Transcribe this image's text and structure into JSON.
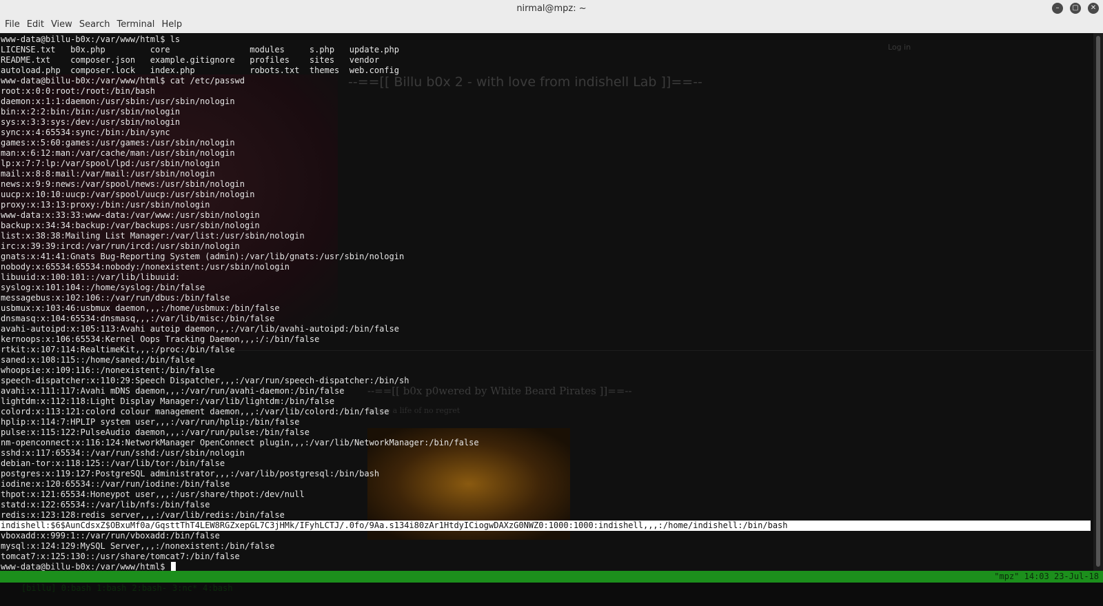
{
  "window": {
    "title": "nirmal@mpz: ~",
    "buttons": [
      "–",
      "▢",
      "✕"
    ]
  },
  "menu": [
    "File",
    "Edit",
    "View",
    "Search",
    "Terminal",
    "Help"
  ],
  "background_page": {
    "login_link": "Log in",
    "header": "--==[[ Billu b0x 2 - with love from indishell Lab ]]==--",
    "footer": "--==[[ b0x p0wered by White Beard Pirates ]]==--",
    "sub": "Leave a life of no regret"
  },
  "terminal": {
    "lines": [
      "www-data@billu-b0x:/var/www/html$ ls",
      "LICENSE.txt   b0x.php         core                modules     s.php   update.php",
      "README.txt    composer.json   example.gitignore   profiles    sites   vendor",
      "autoload.php  composer.lock   index.php           robots.txt  themes  web.config",
      "www-data@billu-b0x:/var/www/html$ cat /etc/passwd",
      "root:x:0:0:root:/root:/bin/bash",
      "daemon:x:1:1:daemon:/usr/sbin:/usr/sbin/nologin",
      "bin:x:2:2:bin:/bin:/usr/sbin/nologin",
      "sys:x:3:3:sys:/dev:/usr/sbin/nologin",
      "sync:x:4:65534:sync:/bin:/bin/sync",
      "games:x:5:60:games:/usr/games:/usr/sbin/nologin",
      "man:x:6:12:man:/var/cache/man:/usr/sbin/nologin",
      "lp:x:7:7:lp:/var/spool/lpd:/usr/sbin/nologin",
      "mail:x:8:8:mail:/var/mail:/usr/sbin/nologin",
      "news:x:9:9:news:/var/spool/news:/usr/sbin/nologin",
      "uucp:x:10:10:uucp:/var/spool/uucp:/usr/sbin/nologin",
      "proxy:x:13:13:proxy:/bin:/usr/sbin/nologin",
      "www-data:x:33:33:www-data:/var/www:/usr/sbin/nologin",
      "backup:x:34:34:backup:/var/backups:/usr/sbin/nologin",
      "list:x:38:38:Mailing List Manager:/var/list:/usr/sbin/nologin",
      "irc:x:39:39:ircd:/var/run/ircd:/usr/sbin/nologin",
      "gnats:x:41:41:Gnats Bug-Reporting System (admin):/var/lib/gnats:/usr/sbin/nologin",
      "nobody:x:65534:65534:nobody:/nonexistent:/usr/sbin/nologin",
      "libuuid:x:100:101::/var/lib/libuuid:",
      "syslog:x:101:104::/home/syslog:/bin/false",
      "messagebus:x:102:106::/var/run/dbus:/bin/false",
      "usbmux:x:103:46:usbmux daemon,,,:/home/usbmux:/bin/false",
      "dnsmasq:x:104:65534:dnsmasq,,,:/var/lib/misc:/bin/false",
      "avahi-autoipd:x:105:113:Avahi autoip daemon,,,:/var/lib/avahi-autoipd:/bin/false",
      "kernoops:x:106:65534:Kernel Oops Tracking Daemon,,,:/:/bin/false",
      "rtkit:x:107:114:RealtimeKit,,,:/proc:/bin/false",
      "saned:x:108:115::/home/saned:/bin/false",
      "whoopsie:x:109:116::/nonexistent:/bin/false",
      "speech-dispatcher:x:110:29:Speech Dispatcher,,,:/var/run/speech-dispatcher:/bin/sh",
      "avahi:x:111:117:Avahi mDNS daemon,,,:/var/run/avahi-daemon:/bin/false",
      "lightdm:x:112:118:Light Display Manager:/var/lib/lightdm:/bin/false",
      "colord:x:113:121:colord colour management daemon,,,:/var/lib/colord:/bin/false",
      "hplip:x:114:7:HPLIP system user,,,:/var/run/hplip:/bin/false",
      "pulse:x:115:122:PulseAudio daemon,,,:/var/run/pulse:/bin/false",
      "nm-openconnect:x:116:124:NetworkManager OpenConnect plugin,,,:/var/lib/NetworkManager:/bin/false",
      "sshd:x:117:65534::/var/run/sshd:/usr/sbin/nologin",
      "debian-tor:x:118:125::/var/lib/tor:/bin/false",
      "postgres:x:119:127:PostgreSQL administrator,,,:/var/lib/postgresql:/bin/bash",
      "iodine:x:120:65534::/var/run/iodine:/bin/false",
      "thpot:x:121:65534:Honeypot user,,,:/usr/share/thpot:/dev/null",
      "statd:x:122:65534::/var/lib/nfs:/bin/false",
      "redis:x:123:128:redis server,,,:/var/lib/redis:/bin/false",
      "indishell:$6$AunCdsxZ$OBxuMf0a/GqsttThT4LEW8RGZxepGL7C3jHMk/IFyhLCTJ/.0fo/9Aa.s134i80zAr1HtdyICiogwDAXzG0NWZ0:1000:1000:indishell,,,:/home/indishell:/bin/bash",
      "vboxadd:x:999:1::/var/run/vboxadd:/bin/false",
      "mysql:x:124:129:MySQL Server,,,:/nonexistent:/bin/false",
      "tomcat7:x:125:130::/usr/share/tomcat7:/bin/false",
      "www-data@billu-b0x:/var/www/html$ "
    ],
    "highlight_line_index": 47
  },
  "status": {
    "windows": [
      "[billu] 0:bash",
      "1:bash",
      "2:bash-",
      "3:nc*",
      "4:bash"
    ],
    "right": "\"mpz\" 14:03 23-Jul-18"
  }
}
